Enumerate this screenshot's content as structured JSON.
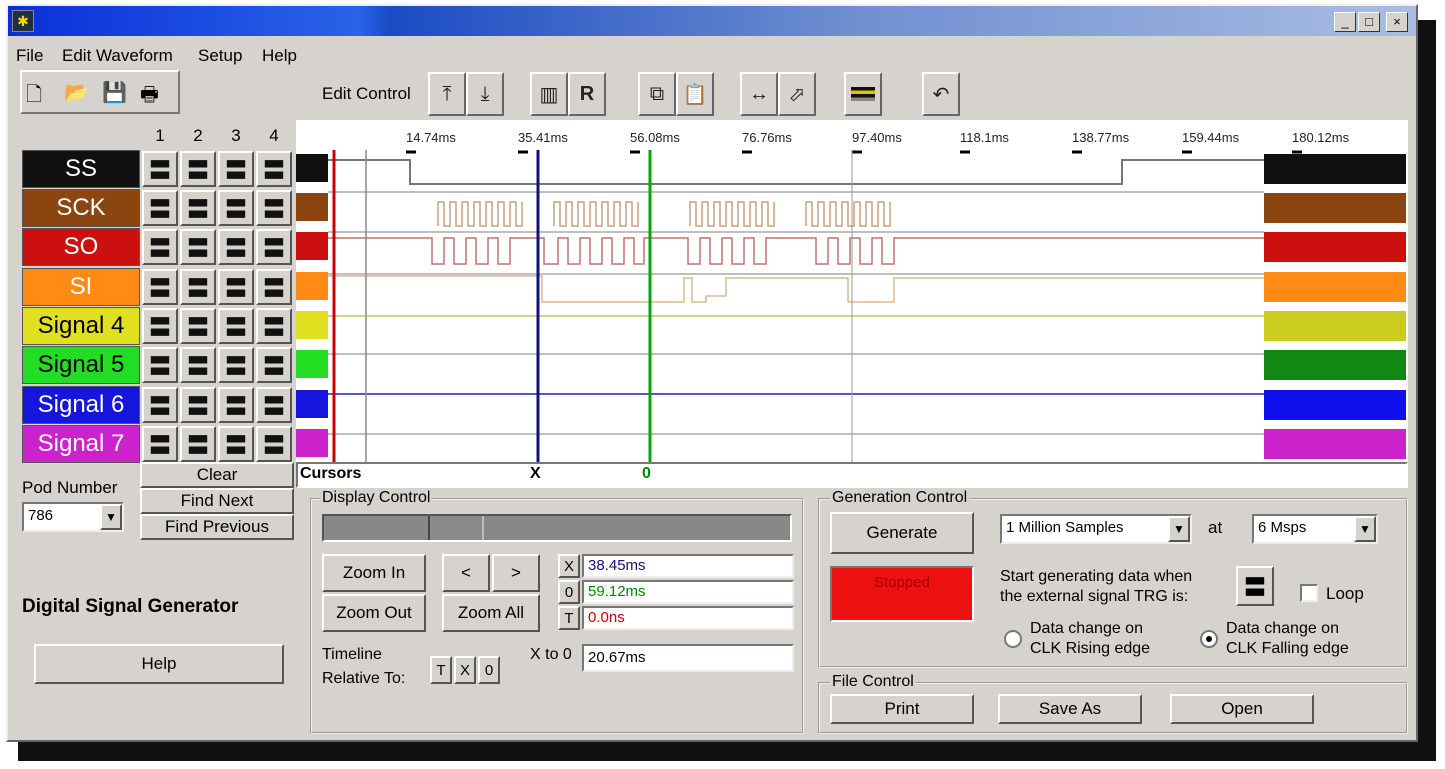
{
  "menu": [
    "File",
    "Edit Waveform",
    "Setup",
    "Help"
  ],
  "toolbar": {
    "edit_control_label": "Edit Control",
    "icons": [
      "new-file-icon",
      "open-folder-icon",
      "save-icon",
      "print-icon",
      "move-up-icon",
      "move-down-icon",
      "measure-icon",
      "record-icon",
      "copy-icon",
      "paste-icon",
      "stretch-icon",
      "pointer-icon",
      "color-lines-icon",
      "undo-icon"
    ]
  },
  "columns": [
    "1",
    "2",
    "3",
    "4"
  ],
  "timeline": [
    "14.74ms",
    "35.41ms",
    "56.08ms",
    "76.76ms",
    "97.40ms",
    "118.1ms",
    "138.77ms",
    "159.44ms",
    "180.12ms"
  ],
  "signals": [
    {
      "name": "SS",
      "color": "#101010",
      "text_color": "#ffffff"
    },
    {
      "name": "SCK",
      "color": "#8b4510",
      "text_color": "#ffffff"
    },
    {
      "name": "SO",
      "color": "#cc1010",
      "text_color": "#ffffff"
    },
    {
      "name": "SI",
      "color": "#ff8a14",
      "text_color": "#ffffff"
    },
    {
      "name": "Signal 4",
      "color": "#e0e020",
      "text_color": "#000000"
    },
    {
      "name": "Signal 5",
      "color": "#22dd22",
      "text_color": "#000000"
    },
    {
      "name": "Signal 6",
      "color": "#1515dd",
      "text_color": "#ffffff"
    },
    {
      "name": "Signal 7",
      "color": "#cc22cc",
      "text_color": "#ffffff"
    }
  ],
  "swatches": [
    "#101010",
    "#8b4510",
    "#cc1010",
    "#ff8a14",
    "#cccc20",
    "#118811",
    "#1010ee",
    "#cc22cc"
  ],
  "search": {
    "clear": "Clear",
    "find_next": "Find Next",
    "find_previous": "Find Previous"
  },
  "cursors": {
    "label": "Cursors",
    "x_marker": "X",
    "o_marker": "0"
  },
  "pod": {
    "label": "Pod Number",
    "value": "786"
  },
  "app_title": "Digital Signal Generator",
  "help_button": "Help",
  "display_control": {
    "title": "Display Control",
    "zoom_in": "Zoom In",
    "zoom_out": "Zoom Out",
    "zoom_all": "Zoom All",
    "prev": "<",
    "next": ">",
    "x_label": "X",
    "x_value": "38.45ms",
    "o_label": "0",
    "o_value": "59.12ms",
    "t_label": "T",
    "t_value": "0.0ns",
    "timeline_label_1": "Timeline",
    "timeline_label_2": "Relative To:",
    "rel_t": "T",
    "rel_x": "X",
    "rel_o": "0",
    "x_to_o_label": "X to 0",
    "x_to_o_value": "20.67ms"
  },
  "generation_control": {
    "title": "Generation Control",
    "generate": "Generate",
    "status": "Stopped",
    "samples": "1 Million Samples",
    "at": "at",
    "rate": "6 Msps",
    "trigger_text_1": "Start generating data when",
    "trigger_text_2": "the external signal TRG is:",
    "loop": "Loop",
    "rising_1": "Data change on",
    "rising_2": "CLK Rising edge",
    "falling_1": "Data change on",
    "falling_2": "CLK Falling edge",
    "selected_edge": "falling"
  },
  "file_control": {
    "title": "File Control",
    "print": "Print",
    "save_as": "Save As",
    "open": "Open"
  },
  "window_buttons": [
    "_",
    "□",
    "×"
  ]
}
